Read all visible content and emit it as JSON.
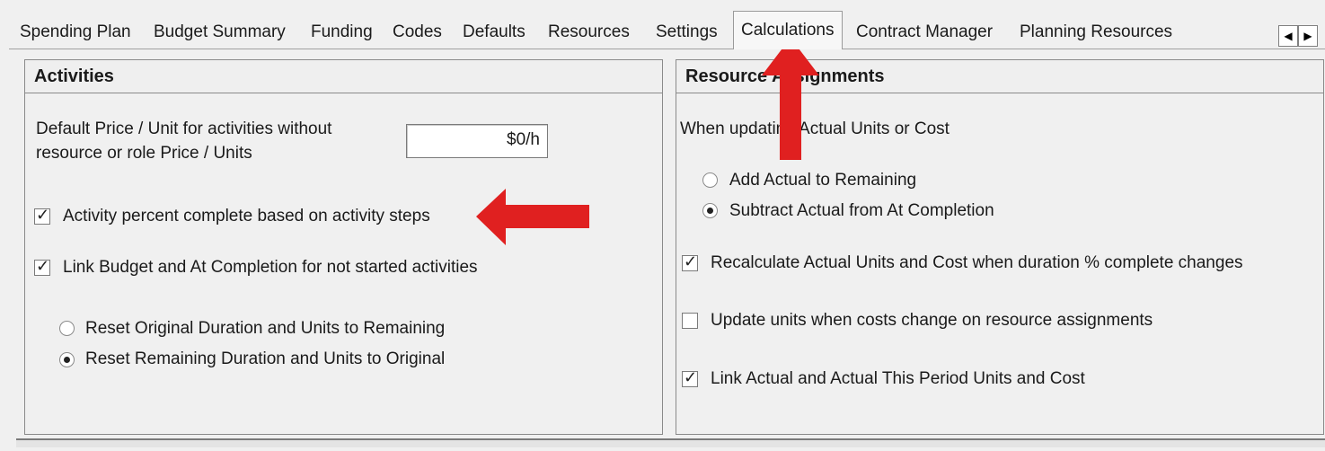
{
  "tabs": [
    {
      "label": "Spending Plan"
    },
    {
      "label": "Budget Summary"
    },
    {
      "label": "Funding"
    },
    {
      "label": "Codes"
    },
    {
      "label": "Defaults"
    },
    {
      "label": "Resources"
    },
    {
      "label": "Settings"
    },
    {
      "label": "Calculations",
      "active": true
    },
    {
      "label": "Contract Manager"
    },
    {
      "label": "Planning Resources"
    }
  ],
  "tab_scroll": {
    "left_icon": "triangle-left-icon",
    "right_icon": "triangle-right-icon",
    "left_glyph": "◀",
    "right_glyph": "▶"
  },
  "activities": {
    "title": "Activities",
    "default_price_label_1": "Default Price / Unit for activities without",
    "default_price_label_2": "resource or role Price / Units",
    "default_price_value": "$0/h",
    "percent_complete_steps": {
      "label": "Activity percent complete based on activity steps",
      "checked": true
    },
    "link_budget": {
      "label": "Link Budget and At Completion for not started activities",
      "checked": true
    },
    "reset_options": [
      {
        "label": "Reset Original Duration and Units to Remaining",
        "selected": false
      },
      {
        "label": "Reset Remaining Duration and Units to Original",
        "selected": true
      }
    ]
  },
  "resource_assignments": {
    "title": "Resource Assignments",
    "updating_label": "When updating Actual Units or Cost",
    "update_options": [
      {
        "label": "Add Actual to Remaining",
        "selected": false
      },
      {
        "label": "Subtract Actual from At Completion",
        "selected": true
      }
    ],
    "recalculate": {
      "label": "Recalculate Actual Units and Cost when duration % complete changes",
      "checked": true
    },
    "update_units": {
      "label": "Update units when costs change on resource assignments",
      "checked": false
    },
    "link_actual": {
      "label": "Link Actual and Actual This Period Units and Cost",
      "checked": true
    }
  },
  "annotation_color": "#e02020",
  "check_glyph": "✓"
}
